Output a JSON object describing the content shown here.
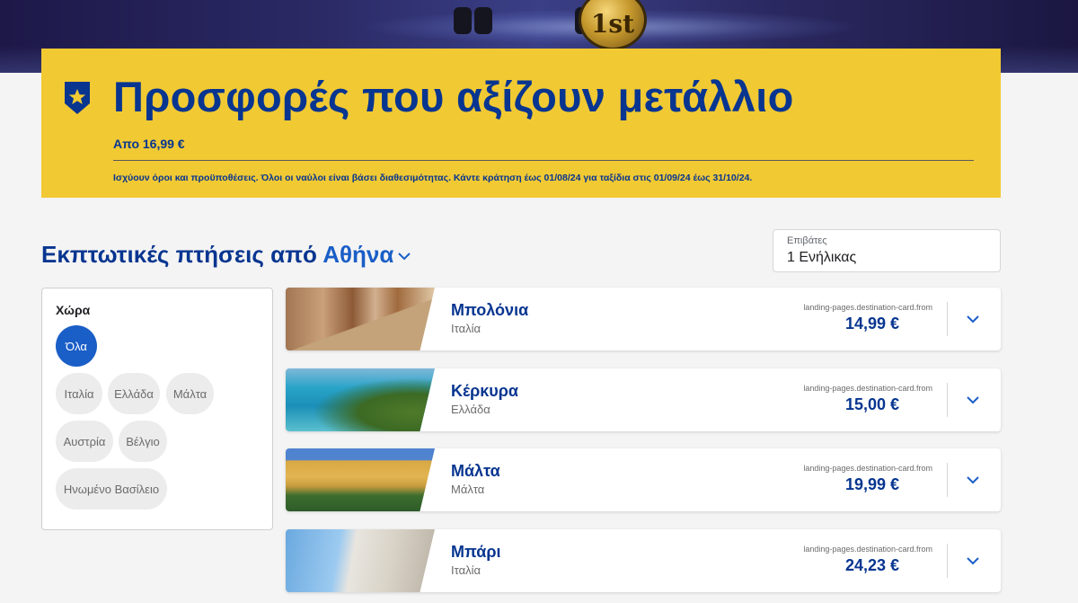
{
  "hero": {
    "medal_text": "1st"
  },
  "banner": {
    "title": "Προσφορές που αξίζουν μετάλλιο",
    "price_line": "Απο 16,99 €",
    "terms": "Ισχύουν όροι και προϋποθέσεις. Όλοι οι ναύλοι είναι βάσει διαθεσιμότητας. Κάντε κράτηση έως 01/08/24 για ταξίδια στις 01/09/24 έως 31/10/24."
  },
  "section": {
    "heading_prefix": "Εκπτωτικές πτήσεις από",
    "origin_city": "Αθήνα"
  },
  "passengers": {
    "label": "Επιβάτες",
    "value": "1 Ενήλικας"
  },
  "filter": {
    "title": "Χώρα",
    "chips": [
      {
        "label": "Όλα",
        "active": true
      },
      {
        "label": "Ιταλία",
        "active": false
      },
      {
        "label": "Ελλάδα",
        "active": false
      },
      {
        "label": "Μάλτα",
        "active": false
      },
      {
        "label": "Αυστρία",
        "active": false
      },
      {
        "label": "Βέλγιο",
        "active": false
      },
      {
        "label": "Ηνωμένο Βασίλειο",
        "active": false
      }
    ]
  },
  "destinations": [
    {
      "name": "Μπολόνια",
      "country": "Ιταλία",
      "from_label": "landing-pages.destination-card.from",
      "price": "14,99 €"
    },
    {
      "name": "Κέρκυρα",
      "country": "Ελλάδα",
      "from_label": "landing-pages.destination-card.from",
      "price": "15,00 €"
    },
    {
      "name": "Μάλτα",
      "country": "Μάλτα",
      "from_label": "landing-pages.destination-card.from",
      "price": "19,99 €"
    },
    {
      "name": "Μπάρι",
      "country": "Ιταλία",
      "from_label": "landing-pages.destination-card.from",
      "price": "24,23 €"
    }
  ],
  "colors": {
    "brand_blue": "#073590",
    "accent_blue": "#1a5ec7",
    "banner_yellow": "#f1c933",
    "page_bg": "#f4f4f4"
  },
  "icons": {
    "banner_badge": "star-shield-icon",
    "city_dropdown": "chevron-down-icon",
    "card_toggle": "chevron-down-icon"
  }
}
